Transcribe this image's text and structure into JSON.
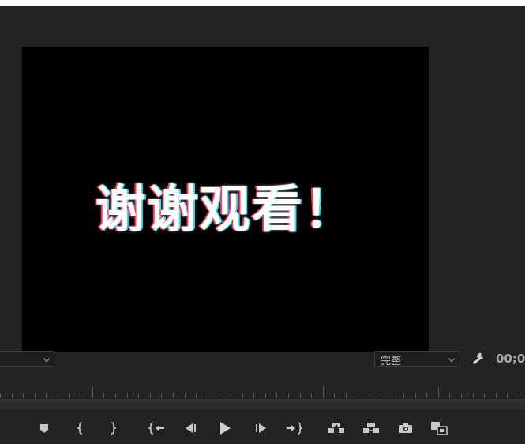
{
  "monitor": {
    "frame_text": "谢谢观看！"
  },
  "controls": {
    "left_dropdown_value": "",
    "quality_dropdown_value": "完整",
    "timecode": "00;0"
  },
  "transport_buttons": [
    {
      "name": "add-marker",
      "icon": "marker-icon"
    },
    {
      "name": "mark-in",
      "icon": "mark-in-icon"
    },
    {
      "name": "mark-out",
      "icon": "mark-out-icon"
    },
    {
      "name": "go-to-in",
      "icon": "go-to-in-icon"
    },
    {
      "name": "step-back",
      "icon": "step-back-icon"
    },
    {
      "name": "play",
      "icon": "play-icon"
    },
    {
      "name": "step-forward",
      "icon": "step-forward-icon"
    },
    {
      "name": "go-to-out",
      "icon": "go-to-out-icon"
    },
    {
      "name": "lift",
      "icon": "lift-icon"
    },
    {
      "name": "extract",
      "icon": "extract-icon"
    },
    {
      "name": "export-frame",
      "icon": "camera-icon"
    },
    {
      "name": "comparison-view",
      "icon": "compare-icon"
    }
  ],
  "colors": {
    "panel_bg": "#232323",
    "video_bg": "#000000",
    "text_fringe_red": "#ff3355",
    "text_fringe_cyan": "#33ddff"
  }
}
